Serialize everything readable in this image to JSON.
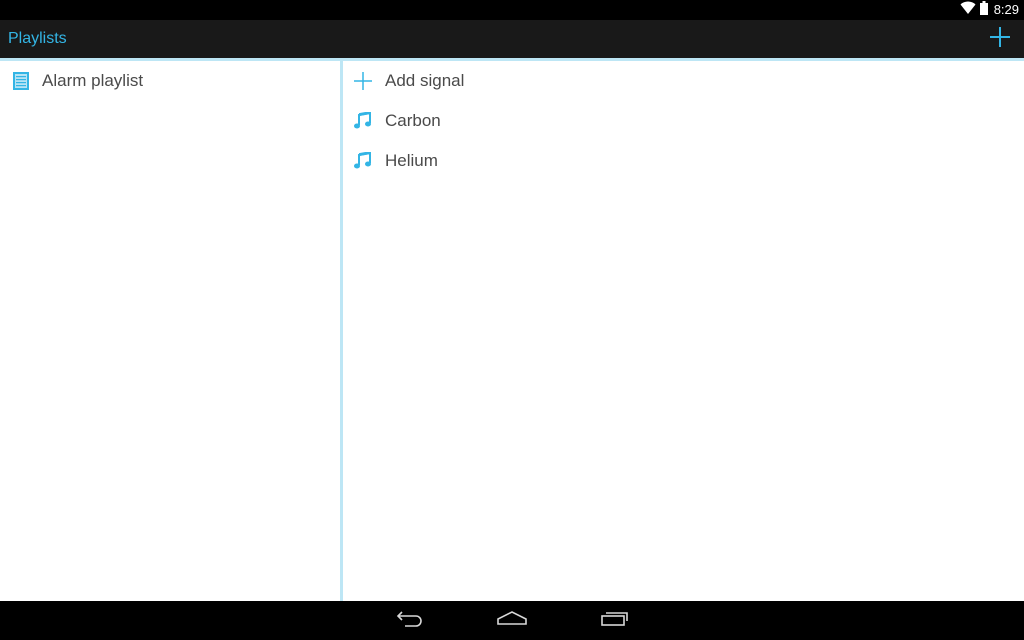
{
  "status_bar": {
    "time": "8:29",
    "icons": [
      "wifi-icon",
      "battery-icon"
    ]
  },
  "action_bar": {
    "title": "Playlists",
    "add_icon": "plus-icon",
    "accent_color": "#33b5e5"
  },
  "playlists": {
    "items": [
      {
        "label": "Alarm playlist",
        "icon": "playlist-icon"
      }
    ]
  },
  "signals": {
    "add_label": "Add signal",
    "items": [
      {
        "label": "Carbon",
        "icon": "music-note-icon"
      },
      {
        "label": "Helium",
        "icon": "music-note-icon"
      }
    ]
  },
  "nav_bar": {
    "buttons": [
      "back-icon",
      "home-icon",
      "recents-icon"
    ]
  },
  "colors": {
    "accent": "#33b5e5",
    "divider": "#bde6f5",
    "action_bar_bg": "#191919",
    "text": "#4a4a4a"
  }
}
